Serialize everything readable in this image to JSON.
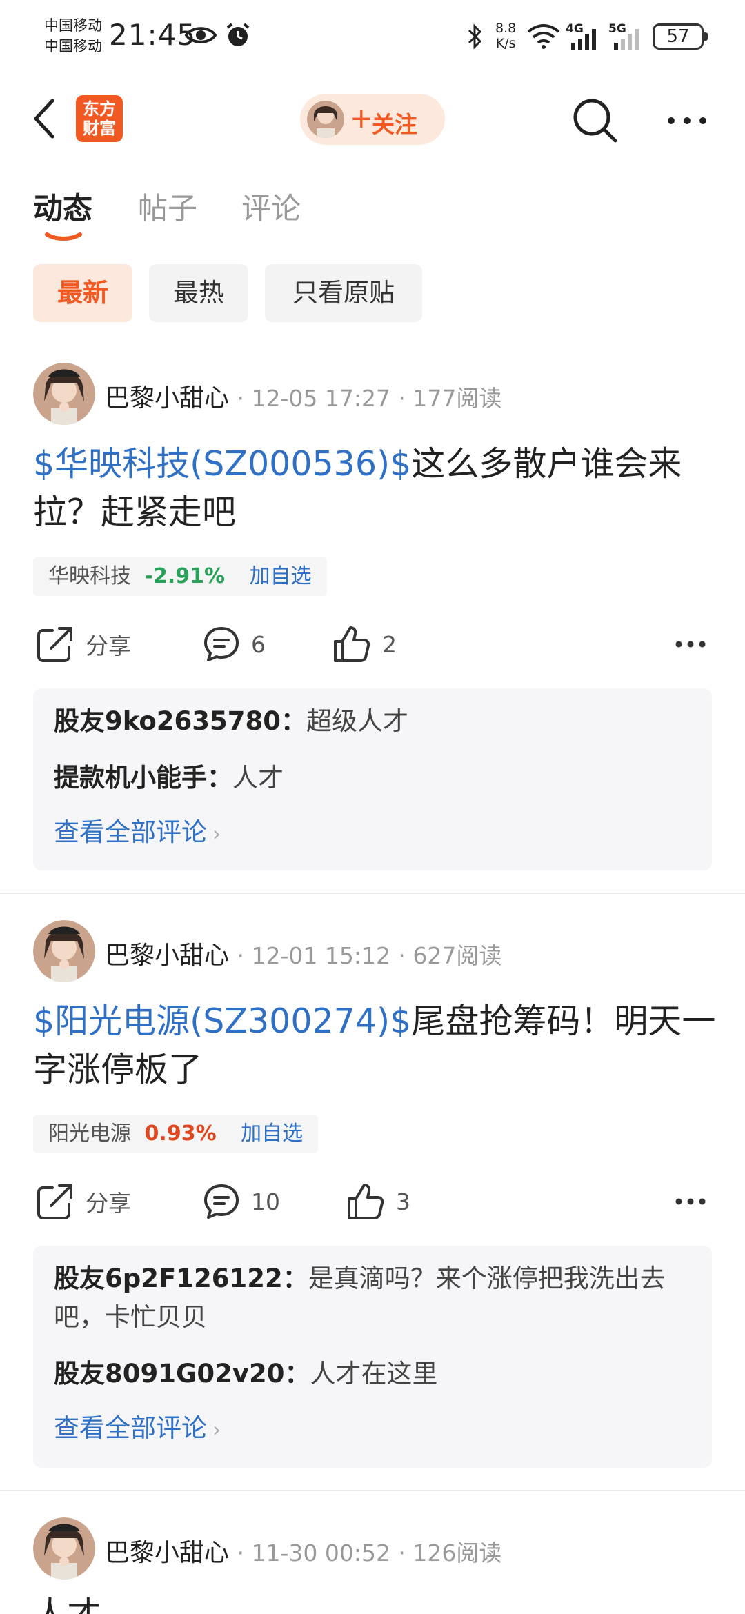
{
  "status_bar": {
    "carrier1": "中国移动",
    "carrier2": "中国移动",
    "time": "21:45",
    "speed_value": "8.8",
    "speed_unit": "K/s",
    "sig1": "4G",
    "sig2": "5G",
    "battery": "57"
  },
  "header": {
    "logo_text_1": "东方",
    "logo_text_2": "财富",
    "follow_label": "关注",
    "plus": "+"
  },
  "tabs": [
    {
      "label": "动态",
      "active": true
    },
    {
      "label": "帖子",
      "active": false
    },
    {
      "label": "评论",
      "active": false
    }
  ],
  "filters": [
    {
      "label": "最新",
      "active": true
    },
    {
      "label": "最热",
      "active": false
    },
    {
      "label": "只看原贴",
      "active": false
    }
  ],
  "posts": [
    {
      "username": "巴黎小甜心",
      "time": "12-05 17:27",
      "reads": "177阅读",
      "stock_link": "$华映科技(SZ000536)$",
      "text": "这么多散户谁会来拉？赶紧走吧",
      "stock_name": "华映科技",
      "stock_change": "-2.91%",
      "stock_change_color": "#2aa15b",
      "add_label": "加自选",
      "share_label": "分享",
      "comment_count": "6",
      "like_count": "2",
      "comments": [
        {
          "user": "股友9ko2635780",
          "text": "超级人才"
        },
        {
          "user": "提款机小能手",
          "text": "人才"
        }
      ],
      "view_all": "查看全部评论"
    },
    {
      "username": "巴黎小甜心",
      "time": "12-01 15:12",
      "reads": "627阅读",
      "stock_link": "$阳光电源(SZ300274)$",
      "text": "尾盘抢筹码！明天一字涨停板了",
      "stock_name": "阳光电源",
      "stock_change": "0.93%",
      "stock_change_color": "#e0451e",
      "add_label": "加自选",
      "share_label": "分享",
      "comment_count": "10",
      "like_count": "3",
      "comments": [
        {
          "user": "股友6p2F126122",
          "text": "是真滴吗？来个涨停把我洗出去吧，卡忙贝贝"
        },
        {
          "user": "股友8091G02v20",
          "text": "人才在这里"
        }
      ],
      "view_all": "查看全部评论"
    },
    {
      "username": "巴黎小甜心",
      "time": "11-30 00:52",
      "reads": "126阅读",
      "text": "人才"
    }
  ],
  "colors": {
    "accent": "#f05a22",
    "link": "#2f6fc4"
  }
}
